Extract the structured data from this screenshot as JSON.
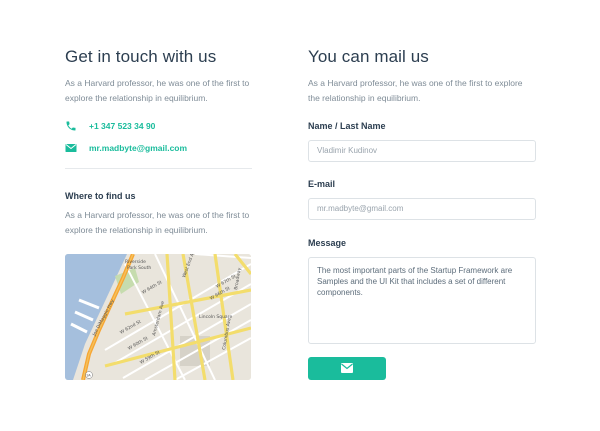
{
  "contact": {
    "title": "Get in touch with us",
    "description": "As a Harvard professor, he was one of the first to explore the relationship in equilibrium.",
    "phone": "+1 347 523 34 90",
    "email": "mr.madbyte@gmail.com",
    "accent_color": "#1abc9c"
  },
  "location": {
    "title": "Where to find us",
    "description": "As a Harvard professor, he was one of the first to explore the relationship in equilibrium.",
    "map_labels": {
      "riverside": "Riverside",
      "park_south": "Park South",
      "hwy": "Joe DiMaggio Hwy",
      "w62": "W 62nd St",
      "w63": "W 63rd St",
      "w64": "W 64th St",
      "w65": "W 65th St",
      "w66": "W 66th St",
      "w67": "W 67th St",
      "w68": "W 68th St",
      "w69": "W 69th St",
      "w60": "W 60th St",
      "w59": "W 59th St",
      "west_end": "West End Ave",
      "amsterdam": "Amsterdam Ave",
      "broadway": "Broadway",
      "lincoln": "Lincoln Square",
      "col_ave": "Columbus Ave",
      "shield": "9A"
    }
  },
  "form": {
    "title": "You can mail us",
    "description": "As a Harvard professor, he was one of the first to explore the relationship in equilibrium.",
    "name_label": "Name / Last Name",
    "name_placeholder": "Vladimir Kudinov",
    "email_label": "E-mail",
    "email_placeholder": "mr.madbyte@gmail.com",
    "message_label": "Message",
    "message_value": "The most important parts of the Startup Framework are Samples and the UI Kit that includes a set of different components.",
    "send_icon": "envelope-icon"
  }
}
